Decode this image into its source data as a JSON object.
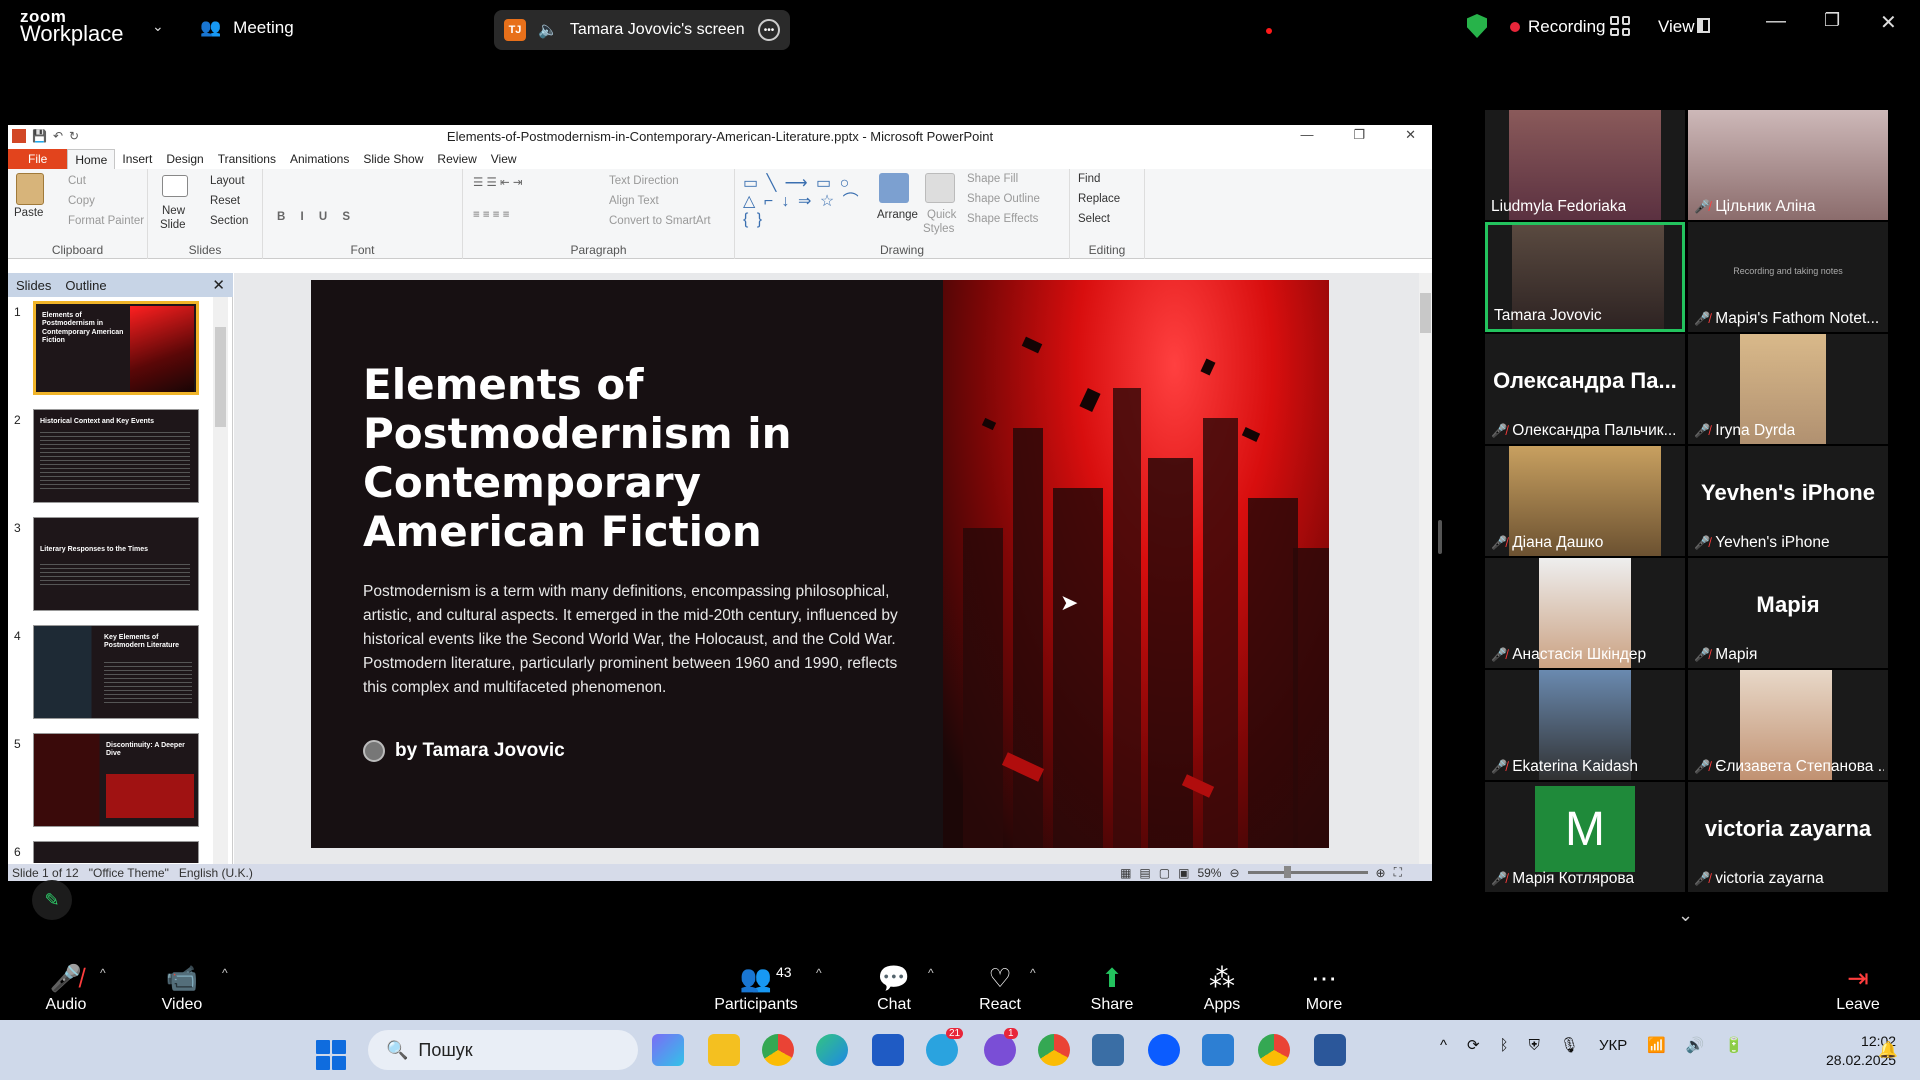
{
  "zoom": {
    "logo_line1": "zoom",
    "logo_line2": "Workplace",
    "meeting_label": "Meeting",
    "share_initials": "TJ",
    "share_label": "Tamara Jovovic's screen",
    "recording_label": "Recording",
    "view_label": "View",
    "accent_green": "#23c35e",
    "record_red": "#e8263a"
  },
  "ppt": {
    "window_title": "Elements-of-Postmodernism-in-Contemporary-American-Literature.pptx - Microsoft PowerPoint",
    "tabs": [
      "File",
      "Home",
      "Insert",
      "Design",
      "Transitions",
      "Animations",
      "Slide Show",
      "Review",
      "View"
    ],
    "ribbon": {
      "clipboard": {
        "label": "Clipboard",
        "paste": "Paste",
        "cut": "Cut",
        "copy": "Copy",
        "format_painter": "Format Painter"
      },
      "slides": {
        "label": "Slides",
        "new_slide_1": "New",
        "new_slide_2": "Slide",
        "layout": "Layout",
        "reset": "Reset",
        "section": "Section"
      },
      "font": {
        "label": "Font"
      },
      "paragraph": {
        "label": "Paragraph",
        "text_direction": "Text Direction",
        "align_text": "Align Text",
        "convert": "Convert to SmartArt"
      },
      "drawing": {
        "label": "Drawing",
        "arrange": "Arrange",
        "quick_styles_1": "Quick",
        "quick_styles_2": "Styles",
        "shape_fill": "Shape Fill",
        "shape_outline": "Shape Outline",
        "shape_effects": "Shape Effects"
      },
      "editing": {
        "label": "Editing",
        "find": "Find",
        "replace": "Replace",
        "select": "Select"
      }
    },
    "pane_tabs": {
      "slides": "Slides",
      "outline": "Outline"
    },
    "thumbnails": [
      {
        "num": "1",
        "title": "Elements of Postmodernism in Contemporary American Fiction"
      },
      {
        "num": "2",
        "title": "Historical Context and Key Events"
      },
      {
        "num": "3",
        "title": "Literary Responses to the Times"
      },
      {
        "num": "4",
        "title": "Key Elements of Postmodern Literature"
      },
      {
        "num": "5",
        "title": "Discontinuity: A Deeper Dive"
      },
      {
        "num": "6",
        "title": ""
      }
    ],
    "slide": {
      "title": "Elements of Postmodernism in Contemporary American Fiction",
      "body": "Postmodernism is a term with many definitions, encompassing philosophical, artistic, and cultural aspects. It emerged in the mid-20th century, influenced by historical events like the Second World War, the Holocaust, and the Cold War. Postmodern literature, particularly prominent between 1960 and 1990, reflects this complex and multifaceted phenomenon.",
      "author": "by Tamara Jovovic"
    },
    "status": {
      "slide": "Slide 1 of 12",
      "theme": "\"Office Theme\"",
      "language": "English (U.K.)",
      "zoom": "59%"
    }
  },
  "participants": [
    {
      "name": "Liudmyla Fedoriaka",
      "muted": false,
      "video": true
    },
    {
      "name": "Цільник Аліна",
      "muted": true,
      "video": true
    },
    {
      "name": "Tamara Jovovic",
      "muted": false,
      "video": true,
      "active": true
    },
    {
      "name": "Марія's Fathom Notet...",
      "muted": true,
      "video": false,
      "caption": "Recording and taking notes"
    },
    {
      "name": "Олександра Пальчик...",
      "muted": true,
      "video": false,
      "big": "Олександра Па..."
    },
    {
      "name": "Iryna Dyrda",
      "muted": true,
      "video": true
    },
    {
      "name": "Діана Дашко",
      "muted": true,
      "video": true
    },
    {
      "name": "Yevhen's iPhone",
      "muted": true,
      "video": false,
      "big": "Yevhen's iPhone"
    },
    {
      "name": "Анастасія Шкіндер",
      "muted": true,
      "video": true
    },
    {
      "name": "Марія",
      "muted": true,
      "video": false,
      "big": "Марія"
    },
    {
      "name": "Ekaterina Kaidash",
      "muted": true,
      "video": true
    },
    {
      "name": "Єлизавета Степанова ...",
      "muted": true,
      "video": true
    },
    {
      "name": "Марія Котлярова",
      "muted": true,
      "video": false,
      "letter": "M"
    },
    {
      "name": "victoria zayarna",
      "muted": true,
      "video": false,
      "big": "victoria zayarna"
    }
  ],
  "controls": {
    "audio": "Audio",
    "video": "Video",
    "participants": "Participants",
    "participants_count": "43",
    "chat": "Chat",
    "react": "React",
    "share": "Share",
    "apps": "Apps",
    "more": "More",
    "leave": "Leave"
  },
  "taskbar": {
    "search_placeholder": "Пошук",
    "telegram_badge": "21",
    "viber_badge": "1",
    "language": "УКР",
    "time": "12:02",
    "date": "28.02.2025"
  }
}
